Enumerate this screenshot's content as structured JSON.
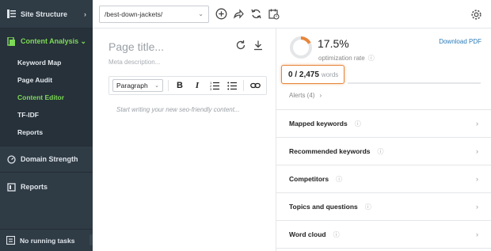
{
  "sidebar": {
    "site_structure": "Site Structure",
    "content_analysis": "Content Analysis",
    "items": [
      "Keyword Map",
      "Page Audit",
      "Content Editor",
      "TF-IDF",
      "Reports"
    ],
    "domain_strength": "Domain Strength",
    "reports": "Reports",
    "no_running_tasks": "No running tasks"
  },
  "topbar": {
    "url_value": "/best-down-jackets/"
  },
  "editor": {
    "page_title_placeholder": "Page title...",
    "meta_description_placeholder": "Meta description...",
    "paragraph_select": "Paragraph",
    "bold": "B",
    "italic": "I",
    "content_placeholder": "Start writing your new seo-friendly content..."
  },
  "score": {
    "percent": "17.5%",
    "percent_value": 17.5,
    "caption": "optimization rate",
    "download": "Download PDF",
    "word_count": "0 / 2,475",
    "word_label": "words",
    "alerts": "Alerts (4)"
  },
  "sections": [
    {
      "label": "Mapped keywords"
    },
    {
      "label": "Recommended keywords"
    },
    {
      "label": "Competitors"
    },
    {
      "label": "Topics and questions"
    },
    {
      "label": "Word cloud"
    }
  ],
  "colors": {
    "sidebar_bg": "#2f3b45",
    "active_green": "#7ed957",
    "ring_orange": "#e8863a",
    "link_blue": "#2a7ab8"
  },
  "icons": [
    "list-icon",
    "document-icon",
    "gauge-icon",
    "reports-icon",
    "tasks-icon",
    "plus-circle-icon",
    "share-icon",
    "refresh-icon",
    "calendar-icon",
    "gear-icon",
    "reload-icon",
    "download-icon",
    "link-icon",
    "bullet-list-icon",
    "numbered-list-icon",
    "info-icon",
    "chevron-right-icon"
  ]
}
